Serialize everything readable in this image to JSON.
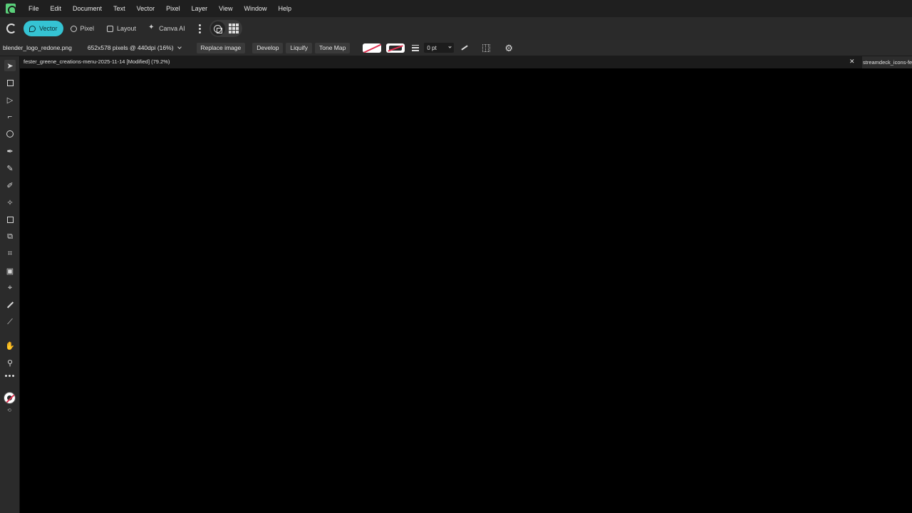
{
  "menubar": {
    "items": [
      "File",
      "Edit",
      "Document",
      "Text",
      "Vector",
      "Pixel",
      "Layer",
      "View",
      "Window",
      "Help"
    ]
  },
  "toolbar": {
    "personas": [
      {
        "label": "Vector",
        "active": true,
        "icon": "vector-persona-icon"
      },
      {
        "label": "Pixel",
        "active": false,
        "icon": "pixel-persona-icon"
      },
      {
        "label": "Layout",
        "active": false,
        "icon": "layout-persona-icon"
      },
      {
        "label": "Canva AI",
        "active": false,
        "icon": "sparkle-icon"
      }
    ],
    "accent_color": "#35c3d3"
  },
  "context": {
    "filename": "blender_logo_redone.png",
    "image_info": "652x578 pixels @ 440dpi (16%)",
    "replace_image": "Replace image",
    "develop": "Develop",
    "liquify": "Liquify",
    "tone_map": "Tone Map",
    "stroke_width": "0 pt"
  },
  "tabs": {
    "active": "fester_greene_creations-menu-2025-11-14 [Modified] (79.2%)",
    "other": "streamdeck_icons-fea"
  },
  "tools": [
    "move-tool-icon",
    "artboard-tool-icon",
    "node-tool-icon",
    "corner-tool-icon",
    "point-transform-icon",
    "pen-tool-icon",
    "pencil-tool-icon",
    "vector-brush-icon",
    "fill-tool-icon",
    "rectangle-tool-icon",
    "shape-builder-icon",
    "frame-text-icon",
    "place-image-icon",
    "crop-tool-icon",
    "measure-tool-icon",
    "color-picker-icon",
    "hand-tool-icon",
    "zoom-tool-icon"
  ]
}
